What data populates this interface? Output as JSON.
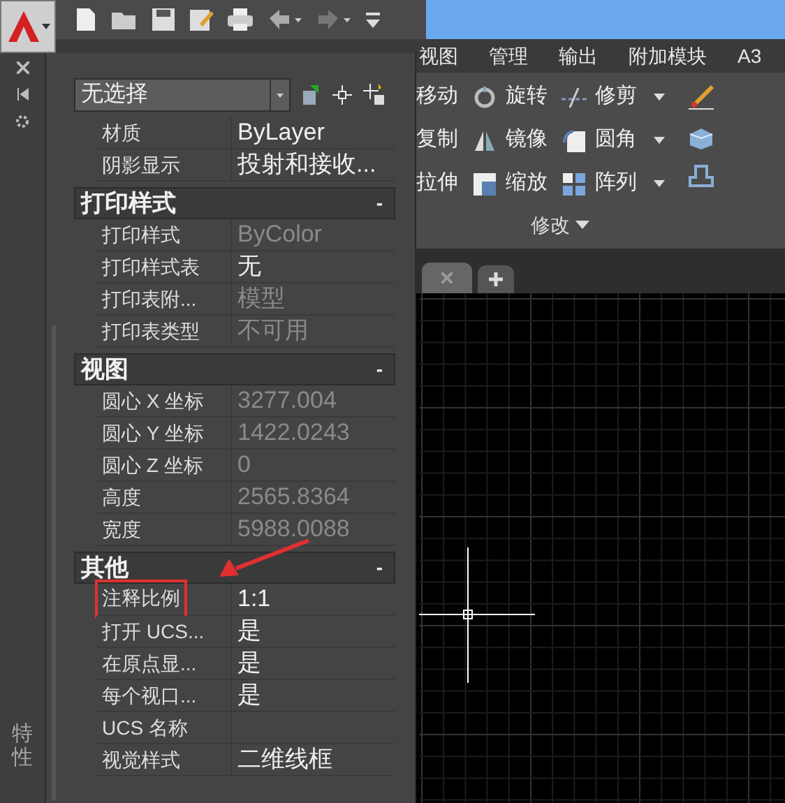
{
  "ribbon_tabs": [
    "视图",
    "管理",
    "输出",
    "附加模块",
    "A3"
  ],
  "ribbon_panel": {
    "title": "修改",
    "columns": [
      [
        {
          "label": "移动",
          "has_menu": false
        },
        {
          "label": "复制",
          "has_menu": false
        },
        {
          "label": "拉伸",
          "has_menu": false
        }
      ],
      [
        {
          "label": "旋转",
          "has_menu": false
        },
        {
          "label": "镜像",
          "has_menu": false
        },
        {
          "label": "缩放",
          "has_menu": false
        }
      ],
      [
        {
          "label": "修剪",
          "has_menu": true
        },
        {
          "label": "圆角",
          "has_menu": true
        },
        {
          "label": "阵列",
          "has_menu": true
        }
      ]
    ]
  },
  "palette": {
    "title": "特性",
    "selection": "无选择",
    "top_rows": [
      {
        "label": "材质",
        "value": "ByLayer",
        "disabled": false,
        "highlighted": false
      },
      {
        "label": "阴影显示",
        "value": "投射和接收...",
        "disabled": false,
        "highlighted": false
      }
    ],
    "sections": [
      {
        "title": "打印样式",
        "toggle": "-",
        "rows": [
          {
            "label": "打印样式",
            "value": "ByColor",
            "disabled": true,
            "highlighted": false
          },
          {
            "label": "打印样式表",
            "value": "无",
            "disabled": false,
            "highlighted": false
          },
          {
            "label": "打印表附...",
            "value": "模型",
            "disabled": true,
            "highlighted": false
          },
          {
            "label": "打印表类型",
            "value": "不可用",
            "disabled": true,
            "highlighted": false
          }
        ]
      },
      {
        "title": "视图",
        "toggle": "-",
        "rows": [
          {
            "label": "圆心 X 坐标",
            "value": "3277.004",
            "disabled": true,
            "highlighted": false
          },
          {
            "label": "圆心 Y 坐标",
            "value": "1422.0243",
            "disabled": true,
            "highlighted": false
          },
          {
            "label": "圆心 Z 坐标",
            "value": "0",
            "disabled": true,
            "highlighted": false
          },
          {
            "label": "高度",
            "value": "2565.8364",
            "disabled": true,
            "highlighted": false
          },
          {
            "label": "宽度",
            "value": "5988.0088",
            "disabled": true,
            "highlighted": false
          }
        ]
      },
      {
        "title": "其他",
        "toggle": "-",
        "rows": [
          {
            "label": "注释比例",
            "value": "1:1",
            "disabled": false,
            "highlighted": true
          },
          {
            "label": "打开 UCS...",
            "value": "是",
            "disabled": false,
            "highlighted": false
          },
          {
            "label": "在原点显...",
            "value": "是",
            "disabled": false,
            "highlighted": false
          },
          {
            "label": "每个视口...",
            "value": "是",
            "disabled": false,
            "highlighted": false
          },
          {
            "label": "UCS 名称",
            "highlighted": false
          },
          {
            "label": "视觉样式",
            "value": "二维线框",
            "disabled": false,
            "highlighted": false
          }
        ]
      }
    ]
  }
}
